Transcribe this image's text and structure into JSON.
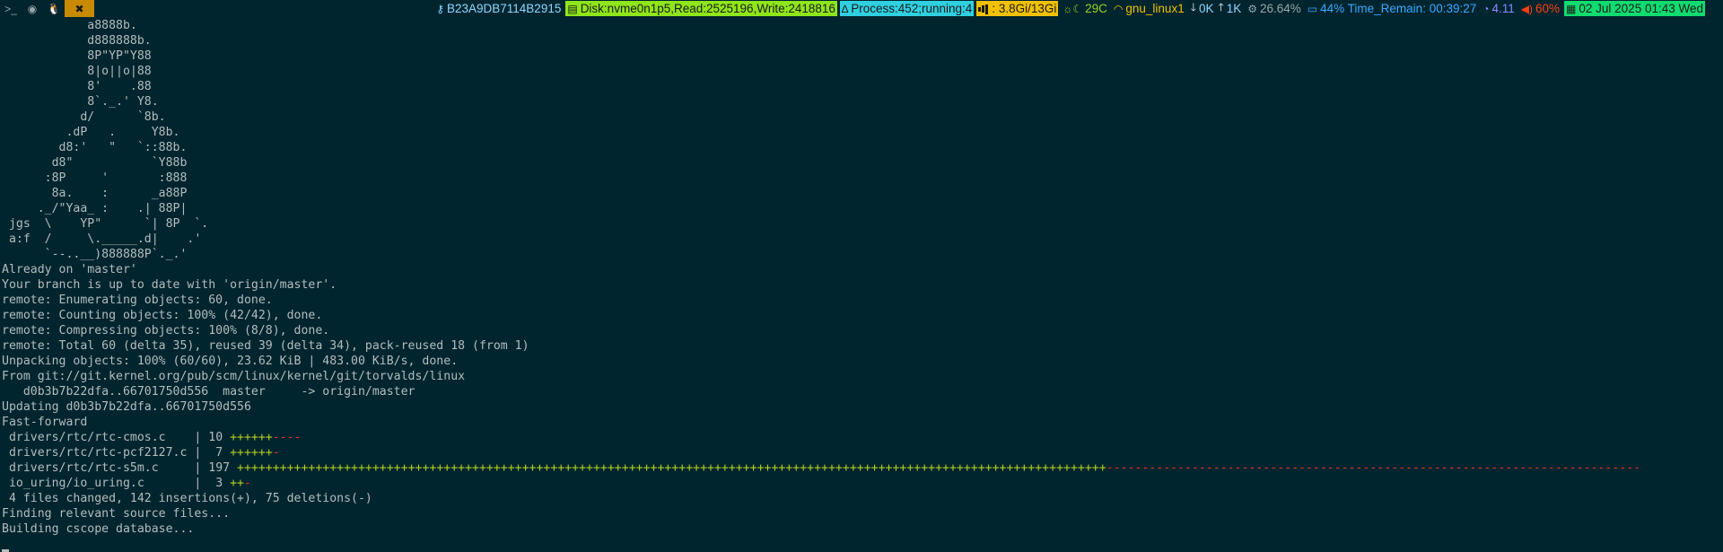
{
  "workspaces": [
    {
      "name": "terminal-icon",
      "glyph": ">_"
    },
    {
      "name": "browser-icon",
      "glyph": "◉"
    },
    {
      "name": "linux-icon",
      "glyph": "🐧"
    },
    {
      "name": "tools-icon",
      "glyph": "✖"
    }
  ],
  "status": {
    "key_id": "B23A9DB7114B2915",
    "disk": "Disk:nvme0n1p5,Read:2525196,Write:2418816",
    "process": "Process:452;running:4",
    "memory": ": 3.8Gi/13Gi",
    "temp": "29C",
    "wifi": "gnu_linux1",
    "down": "0K",
    "up": "1K",
    "cpu": "26.64%",
    "battery": "44% Time_Remain: 00:39:27",
    "load": "4.11",
    "volume": "60%",
    "date": "02 Jul 2025 01:43 Wed",
    "colors": {
      "disk_bg": "#8fe61a",
      "process_bg": "#2fd0e0",
      "mem_bg": "#f0c000",
      "date_bg": "#10dc70",
      "key_fg": "#8fd8ff",
      "temp_fg": "#9ad020",
      "wifi_fg": "#f0c000",
      "net_fg": "#8fd8ff",
      "cpu_fg": "#9aa6a8",
      "bat_fg": "#3aa8ff",
      "load_fg": "#8a8aff",
      "vol_fg": "#ff4010"
    }
  },
  "terminal": {
    "ascii_art": [
      "            a8888b.",
      "            d888888b.",
      "            8P\"YP\"Y88",
      "            8|o||o|88",
      "            8'    .88",
      "            8`._.' Y8.",
      "           d/      `8b.",
      "         .dP   .     Y8b.",
      "        d8:'   \"   `::88b.",
      "       d8\"           `Y88b",
      "      :8P     '       :888",
      "       8a.    :      _a88P",
      "     ._/\"Yaa_ :    .| 88P|",
      " jgs  \\    YP\"      `| 8P  `.",
      " a:f  /     \\._____.d|    .'",
      "      `--..__)888888P`._.'"
    ],
    "output": [
      "Already on 'master'",
      "Your branch is up to date with 'origin/master'.",
      "remote: Enumerating objects: 60, done.",
      "remote: Counting objects: 100% (42/42), done.",
      "remote: Compressing objects: 100% (8/8), done.",
      "remote: Total 60 (delta 35), reused 39 (delta 34), pack-reused 18 (from 1)",
      "Unpacking objects: 100% (60/60), 23.62 KiB | 483.00 KiB/s, done.",
      "From git://git.kernel.org/pub/scm/linux/kernel/git/torvalds/linux",
      "   d0b3b7b22dfa..66701750d556  master     -> origin/master",
      "Updating d0b3b7b22dfa..66701750d556",
      "Fast-forward"
    ],
    "diffstat": [
      {
        "file": " drivers/rtc/rtc-cmos.c    ",
        "count": "| 10 ",
        "plus": 6,
        "minus": 4
      },
      {
        "file": " drivers/rtc/rtc-pcf2127.c ",
        "count": "|  7 ",
        "plus": 6,
        "minus": 1
      },
      {
        "file": " drivers/rtc/rtc-s5m.c     ",
        "count": "| 197 ",
        "plus": 122,
        "minus": 75
      },
      {
        "file": " io_uring/io_uring.c       ",
        "count": "|  3 ",
        "plus": 2,
        "minus": 1
      }
    ],
    "summary": [
      " 4 files changed, 142 insertions(+), 75 deletions(-)",
      "Finding relevant source files...",
      "Building cscope database..."
    ]
  }
}
